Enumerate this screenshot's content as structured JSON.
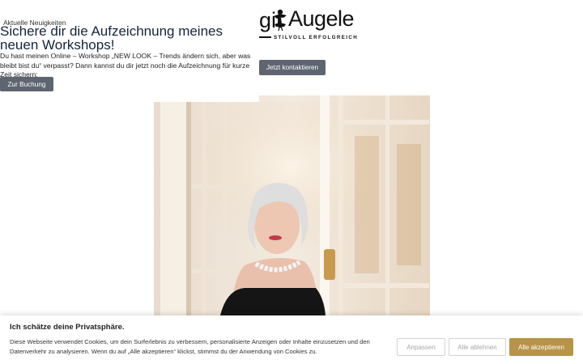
{
  "news": {
    "kicker": "Aktuelle Neuigkeiten",
    "title": "Sichere dir die Aufzeichnung meines neuen Workshops!",
    "text": "Du hast meinen Online – Workshop „NEW LOOK – Trends ändern sich, aber was bleibt bist du“ verpasst? Dann kannst du dir jetzt noch die Aufzeichnung für kurze Zeit sichern:",
    "button": "Zur Buchung"
  },
  "header": {
    "logo_left": "git",
    "logo_name": "Augele",
    "logo_tagline": "STILVOLL ERFOLGREICH",
    "contact_button": "Jetzt kontaktieren"
  },
  "cookie_banner": {
    "title": "Ich schätze deine Privatsphäre.",
    "text": "Diese Webseite verwendet Cookies, um dein Surferlebnis zu verbessern, personalisierte Anzeigen oder Inhalte einzusetzen und den Datenverkehr zu analysieren. Wenn du auf „Alle akzeptieren“ klickst, stimmst du der Anwendung von Cookies zu.",
    "customize_label": "Anpassen",
    "reject_label": "Alle ablehnen",
    "accept_label": "Alle akzeptieren",
    "accept_color": "#b89348"
  },
  "colors": {
    "button_dark": "#5e6570",
    "title": "#13253a"
  }
}
